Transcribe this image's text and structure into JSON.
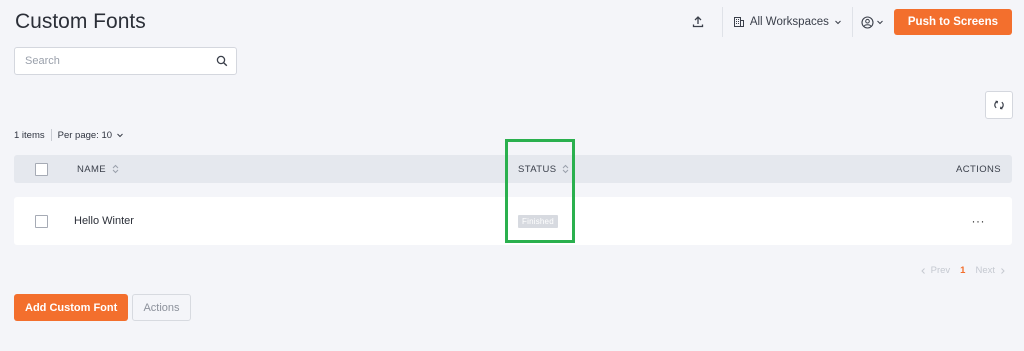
{
  "header": {
    "title": "Custom Fonts",
    "workspace_label": "All Workspaces",
    "push_label": "Push to Screens"
  },
  "search": {
    "placeholder": "Search",
    "value": ""
  },
  "list_meta": {
    "count": "1 items",
    "per_page": "Per page: 10"
  },
  "table": {
    "columns": {
      "name": "NAME",
      "status": "STATUS",
      "actions": "ACTIONS"
    },
    "rows": [
      {
        "name": "Hello Winter",
        "status": "Finished",
        "actions": "···"
      }
    ]
  },
  "pagination": {
    "prev": "Prev",
    "current": "1",
    "next": "Next"
  },
  "footer": {
    "add_label": "Add Custom Font",
    "actions_label": "Actions"
  },
  "colors": {
    "accent": "#f36f2d",
    "highlight": "#2ab04e",
    "background": "#f4f5f9"
  },
  "icons": [
    "upload-icon",
    "building-icon",
    "chevron-down-icon",
    "user-circle-icon",
    "search-icon",
    "refresh-icon",
    "sort-icon",
    "chevron-left-icon",
    "chevron-right-icon",
    "ellipsis-icon"
  ]
}
